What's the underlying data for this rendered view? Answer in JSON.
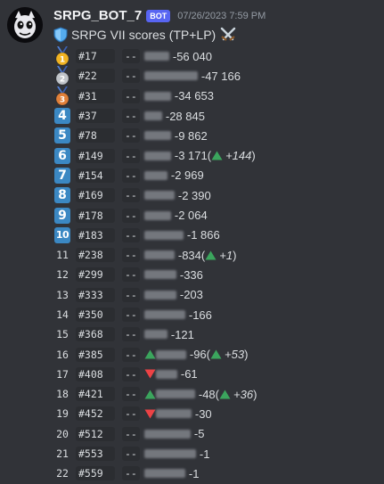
{
  "message": {
    "username": "SRPG_BOT_7",
    "bot_badge": "BOT",
    "timestamp": "07/26/2023 7:59 PM",
    "title": "SRPG VII scores (TP+LP)",
    "icons": {
      "title_left": "shield-icon",
      "title_right": "crossed-swords-icon"
    }
  },
  "colors": {
    "up": "#3ba55d",
    "down": "#ed4245",
    "keycap": "#3b88c3",
    "gold": "#f0b323",
    "silver": "#c0c4c9",
    "bronze": "#e0803a",
    "ribbon": "#4f7fd9"
  },
  "rows": [
    {
      "rank_type": "medal",
      "medal": "gold",
      "rank": "1",
      "id": "#17",
      "score": "56 040",
      "trend": "",
      "change": ""
    },
    {
      "rank_type": "medal",
      "medal": "silver",
      "rank": "2",
      "id": "#22",
      "score": "47 166",
      "trend": "",
      "change": ""
    },
    {
      "rank_type": "medal",
      "medal": "bronze",
      "rank": "3",
      "id": "#31",
      "score": "34 653",
      "trend": "",
      "change": ""
    },
    {
      "rank_type": "keycap",
      "rank": "4",
      "id": "#37",
      "score": "28 845",
      "trend": "",
      "change": ""
    },
    {
      "rank_type": "keycap",
      "rank": "5",
      "id": "#78",
      "score": "9 862",
      "trend": "",
      "change": ""
    },
    {
      "rank_type": "keycap",
      "rank": "6",
      "id": "#149",
      "score": "3 171",
      "trend": "",
      "change": "+144"
    },
    {
      "rank_type": "keycap",
      "rank": "7",
      "id": "#154",
      "score": "2 969",
      "trend": "",
      "change": ""
    },
    {
      "rank_type": "keycap",
      "rank": "8",
      "id": "#169",
      "score": "2 390",
      "trend": "",
      "change": ""
    },
    {
      "rank_type": "keycap",
      "rank": "9",
      "id": "#178",
      "score": "2 064",
      "trend": "",
      "change": ""
    },
    {
      "rank_type": "keycap",
      "rank": "10",
      "id": "#183",
      "score": "1 866",
      "trend": "",
      "change": ""
    },
    {
      "rank_type": "plain",
      "rank": "11",
      "id": "#238",
      "score": "834",
      "trend": "",
      "change": "+1"
    },
    {
      "rank_type": "plain",
      "rank": "12",
      "id": "#299",
      "score": "336",
      "trend": "",
      "change": ""
    },
    {
      "rank_type": "plain",
      "rank": "13",
      "id": "#333",
      "score": "203",
      "trend": "",
      "change": ""
    },
    {
      "rank_type": "plain",
      "rank": "14",
      "id": "#350",
      "score": "166",
      "trend": "",
      "change": ""
    },
    {
      "rank_type": "plain",
      "rank": "15",
      "id": "#368",
      "score": "121",
      "trend": "",
      "change": ""
    },
    {
      "rank_type": "plain",
      "rank": "16",
      "id": "#385",
      "score": "96",
      "trend": "up",
      "change": "+53"
    },
    {
      "rank_type": "plain",
      "rank": "17",
      "id": "#408",
      "score": "61",
      "trend": "down",
      "change": ""
    },
    {
      "rank_type": "plain",
      "rank": "18",
      "id": "#421",
      "score": "48",
      "trend": "up",
      "change": "+36"
    },
    {
      "rank_type": "plain",
      "rank": "19",
      "id": "#452",
      "score": "30",
      "trend": "down",
      "change": ""
    },
    {
      "rank_type": "plain",
      "rank": "20",
      "id": "#512",
      "score": "5",
      "trend": "",
      "change": ""
    },
    {
      "rank_type": "plain",
      "rank": "21",
      "id": "#553",
      "score": "1",
      "trend": "",
      "change": ""
    },
    {
      "rank_type": "plain",
      "rank": "22",
      "id": "#559",
      "score": "1",
      "trend": "",
      "change": ""
    }
  ]
}
